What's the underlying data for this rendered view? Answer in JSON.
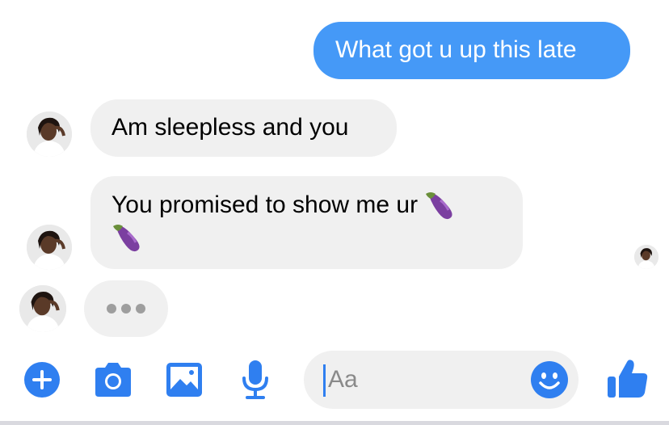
{
  "messages": {
    "sent_1": "What got u up this late",
    "received_1": "Am sleepless and you",
    "received_2": "You promised to show me ur"
  },
  "composer": {
    "placeholder": "Aa",
    "icons": [
      "add-icon",
      "camera-icon",
      "gallery-icon",
      "microphone-icon",
      "emoji-icon",
      "thumbs-up-icon"
    ]
  },
  "colors": {
    "accent": "#4599f7",
    "icon_blue": "#2f7ff0",
    "received_bubble": "#f0f0f0"
  }
}
